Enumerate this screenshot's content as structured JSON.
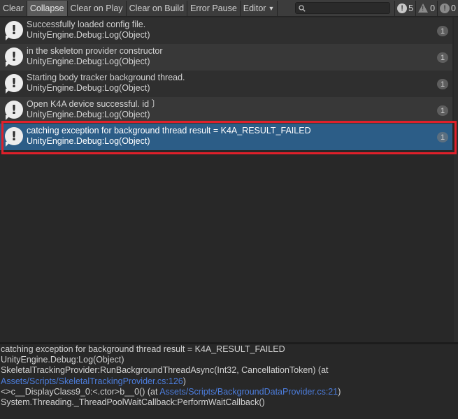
{
  "toolbar": {
    "clear": "Clear",
    "collapse": "Collapse",
    "clear_on_play": "Clear on Play",
    "clear_on_build": "Clear on Build",
    "error_pause": "Error Pause",
    "editor": "Editor",
    "search_placeholder": "",
    "log_count": "5",
    "warning_count": "0",
    "error_count": "0"
  },
  "entries": [
    {
      "line1": "Successfully loaded config file.",
      "line2": "UnityEngine.Debug:Log(Object)",
      "count": "1"
    },
    {
      "line1": "in the skeleton provider constructor",
      "line2": "UnityEngine.Debug:Log(Object)",
      "count": "1"
    },
    {
      "line1": "Starting body tracker background thread.",
      "line2": "UnityEngine.Debug:Log(Object)",
      "count": "1"
    },
    {
      "line1": "Open K4A device successful. id 〕",
      "line2": "UnityEngine.Debug:Log(Object)",
      "count": "1"
    },
    {
      "line1": "catching exception for background thread result = K4A_RESULT_FAILED",
      "line2": "UnityEngine.Debug:Log(Object)",
      "count": "1"
    }
  ],
  "detail": {
    "line1": "catching exception for background thread result = K4A_RESULT_FAILED",
    "line2": "UnityEngine.Debug:Log(Object)",
    "line3": "SkeletalTrackingProvider:RunBackgroundThreadAsync(Int32, CancellationToken) (at",
    "line4_link": "Assets/Scripts/SkeletalTrackingProvider.cs:126",
    "line4_suffix": ")",
    "line5_prefix": "<>c__DisplayClass9_0:<.ctor>b__0() (at ",
    "line5_link": "Assets/Scripts/BackgroundDataProvider.cs:21",
    "line5_suffix": ")",
    "line6": "System.Threading._ThreadPoolWaitCallback:PerformWaitCallback()"
  },
  "colors": {
    "selected_row": "#2c5d87",
    "highlight_border": "#e0202a",
    "link": "#4c7ddc"
  }
}
